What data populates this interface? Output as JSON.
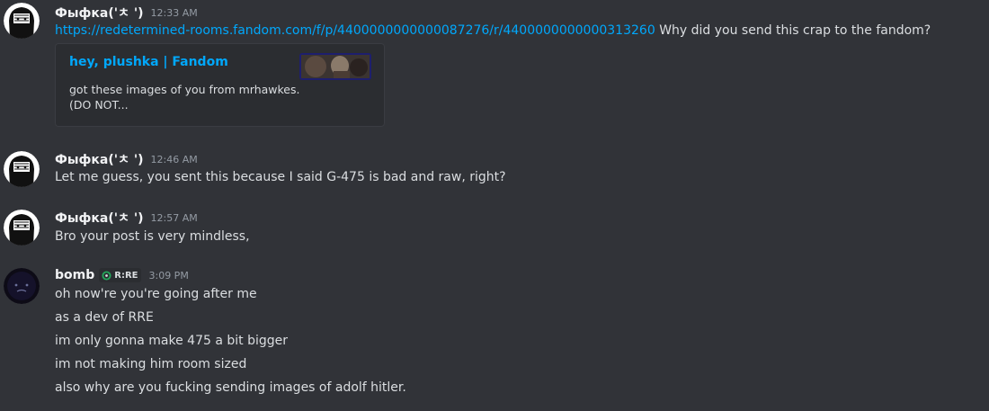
{
  "messages": [
    {
      "author": "Фыфка('ㅊ ')",
      "time": "12:33 AM",
      "link": "https://redetermined-rooms.fandom.com/f/p/4400000000000087276/r/4400000000000313260",
      "text": "Why did you send this crap to the fandom?",
      "embed": {
        "title": "hey, plushka | Fandom",
        "desc_line1": "got these images of you from mrhawkes.",
        "desc_line2": "(DO NOT..."
      }
    },
    {
      "author": "Фыфка('ㅊ ')",
      "time": "12:46 AM",
      "text": "Let me guess, you sent this because I said G-475 is bad and raw, right?"
    },
    {
      "author": "Фыфка('ㅊ ')",
      "time": "12:57 AM",
      "text": "Bro your post is very mindless,"
    },
    {
      "author": "bomb",
      "role": "R:RE",
      "time": "3:09 PM",
      "lines": [
        "oh now're you're going after me",
        "as a dev of RRE",
        "im only gonna make 475 a bit bigger",
        "im not making him room sized",
        "also why are you fucking sending images of adolf hitler."
      ]
    }
  ],
  "colors": {
    "background": "#313338",
    "link": "#00a8fc",
    "embed_background": "#2b2d31",
    "text": "#dbdee1",
    "timestamp": "#949ba4"
  },
  "icons": {
    "user_avatar": "hooded-face-avatar",
    "bomb_avatar": "dark-round-face-avatar",
    "role_icon": "green-ring-icon"
  }
}
